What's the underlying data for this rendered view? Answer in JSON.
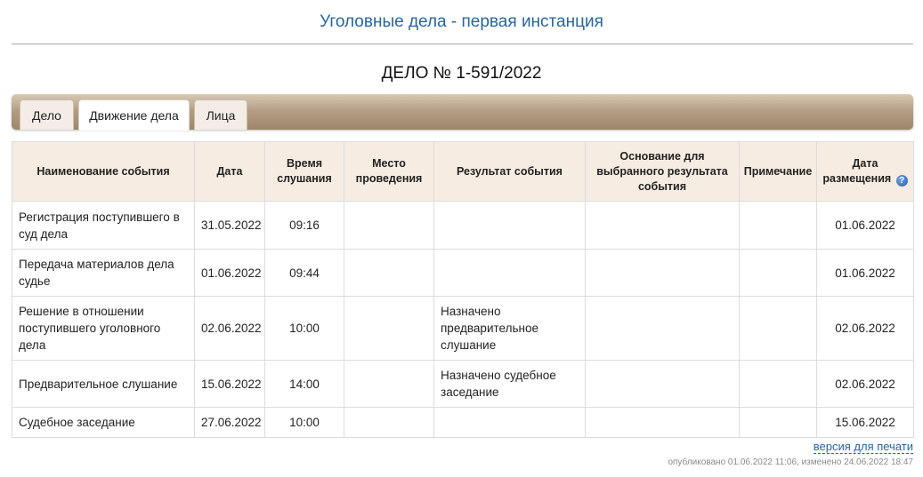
{
  "page": {
    "title": "Уголовные дела - первая инстанция",
    "case_number": "ДЕЛО № 1-591/2022"
  },
  "tabs": [
    {
      "label": "Дело",
      "active": false
    },
    {
      "label": "Движение дела",
      "active": true
    },
    {
      "label": "Лица",
      "active": false
    }
  ],
  "table": {
    "headers": {
      "event_name": "Наименование события",
      "date": "Дата",
      "hearing_time": "Время слушания",
      "venue": "Место проведения",
      "result": "Результат события",
      "basis": "Основание для выбранного результата события",
      "note": "Примечание",
      "posted_date": "Дата размещения"
    },
    "rows": [
      {
        "event_name": "Регистрация поступившего в суд дела",
        "date": "31.05.2022",
        "hearing_time": "09:16",
        "venue": "",
        "result": "",
        "basis": "",
        "note": "",
        "posted_date": "01.06.2022"
      },
      {
        "event_name": "Передача материалов дела судье",
        "date": "01.06.2022",
        "hearing_time": "09:44",
        "venue": "",
        "result": "",
        "basis": "",
        "note": "",
        "posted_date": "01.06.2022"
      },
      {
        "event_name": "Решение в отношении поступившего уголовного дела",
        "date": "02.06.2022",
        "hearing_time": "10:00",
        "venue": "",
        "result": "Назначено предварительное слушание",
        "basis": "",
        "note": "",
        "posted_date": "02.06.2022"
      },
      {
        "event_name": "Предварительное слушание",
        "date": "15.06.2022",
        "hearing_time": "14:00",
        "venue": "",
        "result": "Назначено судебное заседание",
        "basis": "",
        "note": "",
        "posted_date": "02.06.2022"
      },
      {
        "event_name": "Судебное заседание",
        "date": "27.06.2022",
        "hearing_time": "10:00",
        "venue": "",
        "result": "",
        "basis": "",
        "note": "",
        "posted_date": "15.06.2022"
      }
    ]
  },
  "icons": {
    "help": "help-icon"
  },
  "help_glyph": "?",
  "footer": {
    "print_link": "версия для печати",
    "published": "опубликовано 01.06.2022 11:06, изменено 24.06.2022 18:47"
  },
  "colors": {
    "title": "#2a6597",
    "tab_bar": "#b49f85",
    "header_bg": "#f6ece2",
    "link": "#2a6597"
  }
}
